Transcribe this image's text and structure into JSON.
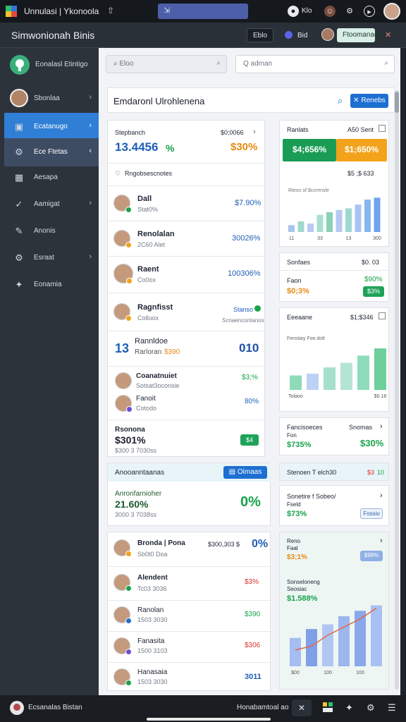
{
  "os": {
    "app_title": "Unnulasi | Ykonoola",
    "pin": "⇧",
    "center_tab": "⇲",
    "status_label": "Klo",
    "colors": {
      "green": "#2fbf71",
      "blue": "#3a73d8",
      "yellow": "#f2c230",
      "red": "#e34b3f"
    }
  },
  "header": {
    "title": "Simwonionah Binis",
    "chip1": "Eblo",
    "chip2": "Bid",
    "chip3": "Ftoomanaem",
    "close": "✕"
  },
  "sidebar": {
    "brand": "Eonalasl Etintigo",
    "items": [
      {
        "label": "Sbonlaa",
        "icon": "avatar"
      },
      {
        "label": "Ecatanugo",
        "icon": "▣"
      },
      {
        "label": "Ece Ftetas",
        "icon": "⚙"
      },
      {
        "label": "Aesapa",
        "icon": "▦"
      },
      {
        "label": "Aamigat",
        "icon": "✓"
      },
      {
        "label": "Anonis",
        "icon": "✎"
      },
      {
        "label": "Esraat",
        "icon": "⚙"
      },
      {
        "label": "Eonamia",
        "icon": "✦"
      }
    ]
  },
  "main": {
    "search_placeholder": "Eloo",
    "search2_placeholder": "Q adman",
    "page_title": "Emdaronl Ulrohlenena",
    "title_button": "Renebs",
    "summary": {
      "label": "Stepbanch",
      "right_label": "$0;0066",
      "value_blue": "13.4456",
      "value_green": "%",
      "value_orange": "$30%"
    },
    "section_label": "Rngobsescnotes",
    "people": [
      {
        "name": "Dall",
        "sub": "Stat0%",
        "value": "$7.90%",
        "tone": "blue"
      },
      {
        "name": "Renolalan",
        "sub": "2C60 Alet",
        "value": "30026%",
        "tone": "blue"
      },
      {
        "name": "Raent",
        "sub": "Co0ox",
        "value": "100306%",
        "tone": "blue"
      },
      {
        "name": "Ragnfisst",
        "sub": "Colluox",
        "value": "Stanso",
        "sub2": "Scnaencontanos",
        "tone": "blue"
      }
    ],
    "bigrow": {
      "digit": "13",
      "name": "Rannldoe",
      "sub": "Rarloran",
      "sub_val": "$390",
      "value": "010"
    },
    "pair": [
      {
        "name": "Coanatnuiet",
        "sub": "Sotsat3oconsie",
        "value": "$3;%"
      },
      {
        "name": "Fanoit",
        "sub": "Cotodo",
        "value": "80%"
      }
    ],
    "total": {
      "label": "Rsonona",
      "value": "$301%",
      "sub": "$300 3 7030ss",
      "pill": "$4"
    },
    "agreement": {
      "label": "Anooanntaanas",
      "button": "Oimaas",
      "sub": "Anronfarnioher",
      "value": "21.60%",
      "sub2": "3000 3 7038ss",
      "right": "0%"
    },
    "list": [
      {
        "name": "Bronda | Pona",
        "sub": "Sb0t0 Doa",
        "mid": "$300,303 $",
        "value": "0%",
        "tone": "blue"
      },
      {
        "name": "Alendent",
        "sub": "Tc03 3036",
        "value": "$3%",
        "tone": "red"
      },
      {
        "name": "Ranolan",
        "sub": "1503 3030",
        "value": "$390",
        "tone": "green"
      },
      {
        "name": "Fanasita",
        "sub": "1500 3103",
        "value": "$306",
        "tone": "red"
      },
      {
        "name": "Hanasaia",
        "sub": "1503 3030",
        "value": "3011",
        "tone": "blue"
      }
    ],
    "right": {
      "card1": {
        "label": "Ranlats",
        "right": "A50 Sent",
        "tile1": "$4;656%",
        "tile2": "$1;650%",
        "sub": "$5 ;$ 633",
        "xaxis": [
          "11",
          "33",
          "13",
          "300"
        ],
        "legend": "Rtesn of $ccrensle"
      },
      "card2": {
        "label": "Sonfaes",
        "right": "$0. 03",
        "row1": "Faon",
        "row1_val": "$90%",
        "val_orange": "$0;3%",
        "pill": "$3%"
      },
      "card3": {
        "label": "Eeeaane",
        "right": "$1;$346",
        "legend": "Fenstiay Foe.dolt",
        "xaxis": [
          "Tolaoo",
          "$0.18"
        ]
      },
      "card4": {
        "label": "Fancisoeces",
        "right": "Snomas",
        "row": "Fon",
        "left_val": "$735%",
        "right_val": "$30%"
      },
      "card5": {
        "label": "Stenoen T elch30",
        "right_red": "$3",
        "right_green": "10"
      },
      "card6": {
        "label": "Sonetire f Sobeo/",
        "sub": "Fseld",
        "value": "$73%",
        "pill": "Fossio"
      },
      "card7": {
        "label": "Reno",
        "sub": "Faal",
        "value": "$3;1%",
        "pill": "$99%"
      },
      "card8": {
        "label": "Sonseloneng",
        "sub": "Seosiac",
        "value": "$1.588%",
        "xaxis": [
          "$00",
          "100",
          "100"
        ]
      }
    }
  },
  "chart_data": [
    {
      "type": "bar",
      "categories": [
        "11",
        "",
        "",
        "33",
        "",
        "",
        "13",
        "",
        "",
        "300"
      ],
      "values": [
        18,
        28,
        22,
        45,
        52,
        58,
        62,
        72,
        85,
        90
      ],
      "ylim": [
        0,
        100
      ]
    },
    {
      "type": "bar",
      "categories": [
        "Tolaoo",
        "",
        "",
        "",
        "",
        "$0.18"
      ],
      "values": [
        32,
        36,
        50,
        60,
        76,
        92
      ],
      "ylim": [
        0,
        100
      ]
    },
    {
      "type": "bar",
      "categories": [
        "$00",
        "",
        "100",
        "",
        "100",
        ""
      ],
      "values": [
        42,
        55,
        62,
        74,
        82,
        90
      ],
      "line": [
        24,
        30,
        46,
        58,
        70,
        86
      ],
      "ylim": [
        0,
        100
      ]
    }
  ],
  "footer": {
    "label": "Ecsanalas Bistan",
    "right": "Honabamtoal ao"
  }
}
